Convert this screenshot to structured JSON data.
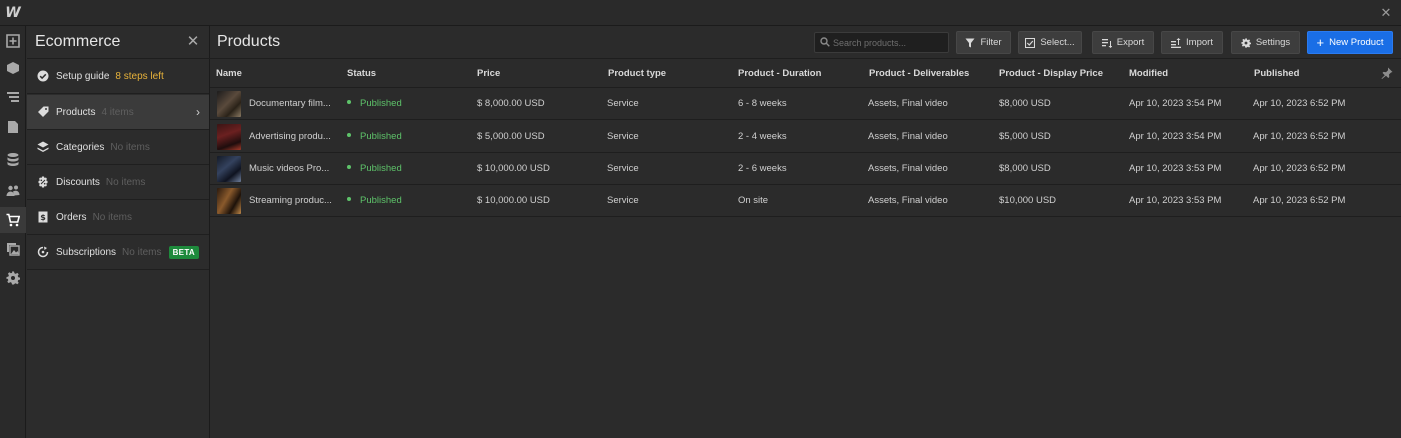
{
  "app": {
    "logo": "W"
  },
  "panel": {
    "title": "Ecommerce",
    "items": [
      {
        "label": "Setup guide",
        "sub": "8 steps left",
        "icon": "check-circle-icon"
      },
      {
        "label": "Products",
        "sub": "4 items",
        "icon": "tag-icon"
      },
      {
        "label": "Categories",
        "sub": "No items",
        "icon": "layers-icon"
      },
      {
        "label": "Discounts",
        "sub": "No items",
        "icon": "discount-icon"
      },
      {
        "label": "Orders",
        "sub": "No items",
        "icon": "receipt-icon"
      },
      {
        "label": "Subscriptions",
        "sub": "No items",
        "icon": "refresh-icon",
        "badge": "BETA"
      }
    ]
  },
  "main": {
    "title": "Products",
    "search_placeholder": "Search products...",
    "buttons": {
      "filter": "Filter",
      "select": "Select...",
      "export": "Export",
      "import": "Import",
      "settings": "Settings",
      "new_product": "New Product"
    }
  },
  "table": {
    "columns": [
      "Name",
      "Status",
      "Price",
      "Product type",
      "Product - Duration",
      "Product - Deliverables",
      "Product - Display Price",
      "Modified",
      "Published"
    ],
    "rows": [
      {
        "name": "Documentary film...",
        "status": "Published",
        "price": "$ 8,000.00 USD",
        "type": "Service",
        "duration": "6 - 8 weeks",
        "deliverables": "Assets, Final video",
        "display_price": "$8,000 USD",
        "modified": "Apr 10, 2023 3:54 PM",
        "published": "Apr 10, 2023 6:52 PM"
      },
      {
        "name": "Advertising produ...",
        "status": "Published",
        "price": "$ 5,000.00 USD",
        "type": "Service",
        "duration": "2 - 4 weeks",
        "deliverables": "Assets, Final video",
        "display_price": "$5,000 USD",
        "modified": "Apr 10, 2023 3:54 PM",
        "published": "Apr 10, 2023 6:52 PM"
      },
      {
        "name": "Music videos Pro...",
        "status": "Published",
        "price": "$ 10,000.00 USD",
        "type": "Service",
        "duration": "2 - 6 weeks",
        "deliverables": "Assets, Final video",
        "display_price": "$8,000 USD",
        "modified": "Apr 10, 2023 3:53 PM",
        "published": "Apr 10, 2023 6:52 PM"
      },
      {
        "name": "Streaming produc...",
        "status": "Published",
        "price": "$ 10,000.00 USD",
        "type": "Service",
        "duration": "On site",
        "deliverables": "Assets, Final video",
        "display_price": "$10,000 USD",
        "modified": "Apr 10, 2023 3:53 PM",
        "published": "Apr 10, 2023 6:52 PM"
      }
    ]
  },
  "colors": {
    "accent": "#1a6ee6",
    "published": "#5ec36a",
    "warning": "#e7b23a",
    "beta": "#1e8a3c",
    "background": "#2b2b2b"
  }
}
